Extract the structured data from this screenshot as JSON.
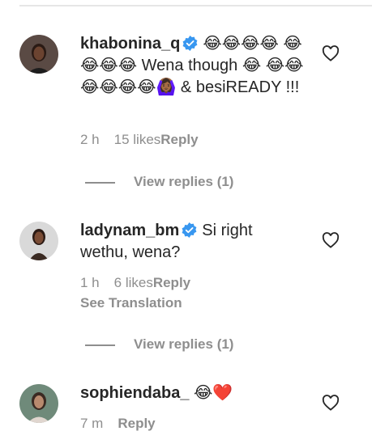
{
  "comments": [
    {
      "username": "khabonina_q",
      "verified": true,
      "text": "😂😂😂😂 😂😂😂😂 Wena though 😂 😂😂😂😂😂😂🙆🏾‍♀️ & besiREADY !!!",
      "time": "2 h",
      "likes": "15 likes",
      "reply": "Reply",
      "view_replies": "View replies (1)"
    },
    {
      "username": "ladynam_bm",
      "verified": true,
      "text": "Si right wethu, wena?",
      "time": "1 h",
      "likes": "6 likes",
      "reply": "Reply",
      "see_translation": "See Translation",
      "view_replies": "View replies (1)"
    },
    {
      "username": "sophiendaba_",
      "verified": false,
      "text": "😂❤️",
      "time": "7 m",
      "reply": "Reply"
    }
  ],
  "icons": {
    "like": "heart-outline-icon",
    "verified": "verified-badge-icon"
  },
  "colors": {
    "verified_blue": "#3897f0",
    "secondary_text": "#8e8e8e",
    "primary_text": "#262626"
  }
}
